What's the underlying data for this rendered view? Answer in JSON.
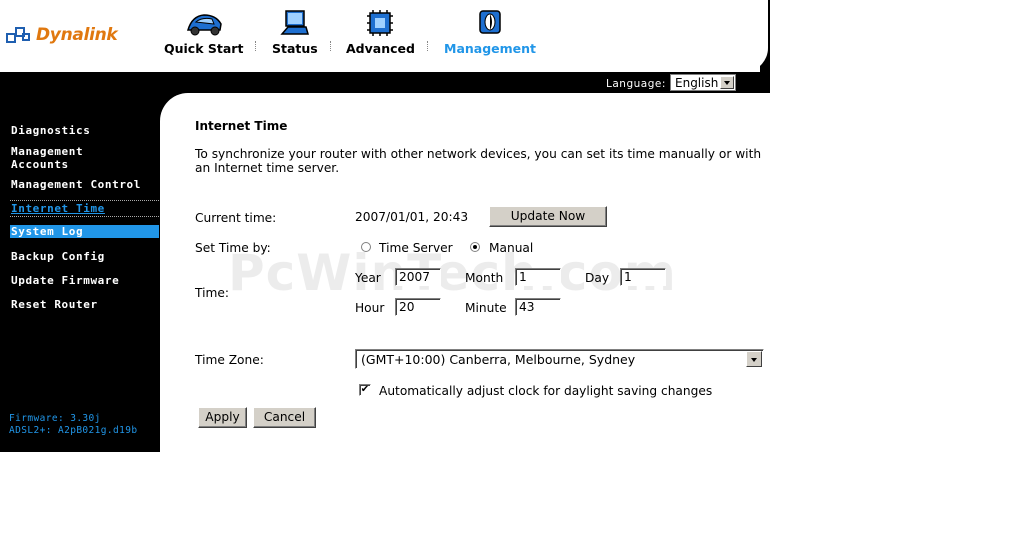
{
  "brand": {
    "name": "Dynalink",
    "color": "#e0780f"
  },
  "nav": [
    {
      "label": "Quick Start",
      "icon": "car-icon"
    },
    {
      "label": "Status",
      "icon": "laptop-icon"
    },
    {
      "label": "Advanced",
      "icon": "chip-icon"
    },
    {
      "label": "Management",
      "icon": "management-icon",
      "active": true
    }
  ],
  "language": {
    "label": "Language:",
    "selected": "English"
  },
  "sidebar": {
    "items": [
      {
        "label": "Diagnostics"
      },
      {
        "label": "Management\nAccounts"
      },
      {
        "label": "Management Control"
      },
      {
        "label": "Internet Time",
        "current": true
      },
      {
        "label": "System Log",
        "highlighted": true
      },
      {
        "label": "Backup Config"
      },
      {
        "label": "Update Firmware"
      },
      {
        "label": "Reset Router"
      }
    ],
    "firmware": "Firmware: 3.30j",
    "adsl": "ADSL2+: A2pB021g.d19b"
  },
  "page": {
    "title": "Internet Time",
    "intro": "To synchronize your router with other network devices, you can set its time manually or with an Internet time server.",
    "current_time_label": "Current time:",
    "current_time_value": "2007/01/01, 20:43",
    "update_now": "Update Now",
    "set_time_by_label": "Set Time by:",
    "option_time_server": "Time Server",
    "option_manual": "Manual",
    "selected_option": "Manual",
    "time_label": "Time:",
    "year_label": "Year",
    "year_value": "2007",
    "month_label": "Month",
    "month_value": "1",
    "day_label": "Day",
    "day_value": "1",
    "hour_label": "Hour",
    "hour_value": "20",
    "minute_label": "Minute",
    "minute_value": "43",
    "time_zone_label": "Time Zone:",
    "time_zone_value": "(GMT+10:00) Canberra, Melbourne, Sydney",
    "dst_checked": true,
    "dst_label": "Automatically adjust clock for daylight saving changes",
    "apply": "Apply",
    "cancel": "Cancel"
  },
  "watermark": "PcWinTech.com",
  "colors": {
    "accent": "#2196e8",
    "sidebar_bg": "#000000"
  }
}
